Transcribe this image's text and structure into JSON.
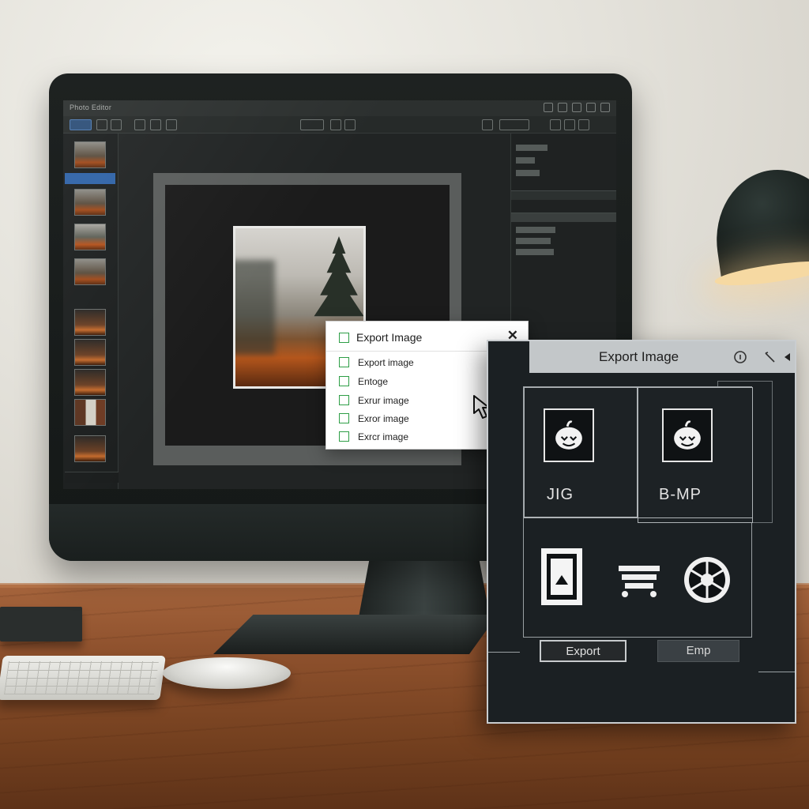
{
  "app": {
    "title": "Photo Editor"
  },
  "menu": {
    "header_label": "Export Image",
    "close_glyph": "✕",
    "items": [
      {
        "label": "Export image"
      },
      {
        "label": "Entoge"
      },
      {
        "label": "Exrur image"
      },
      {
        "label": "Exror image"
      },
      {
        "label": "Exrcr image"
      }
    ]
  },
  "dialog": {
    "title": "Export Image",
    "formats": [
      {
        "label": "JIG",
        "icon": "pumpkin-icon"
      },
      {
        "label": "B-MP",
        "icon": "pumpkin-icon"
      }
    ],
    "bottom_icons": [
      "framed-image-icon",
      "print-tray-icon",
      "aperture-icon"
    ],
    "buttons": {
      "export_label": "Export",
      "emp_label": "Emp"
    },
    "header_icons": [
      "info-icon",
      "pen-icon",
      "collapse-arrow-icon"
    ]
  },
  "colors": {
    "accent_green": "#2e9e46",
    "selection_blue": "#2f63a7",
    "dialog_bg": "#1b2023"
  }
}
